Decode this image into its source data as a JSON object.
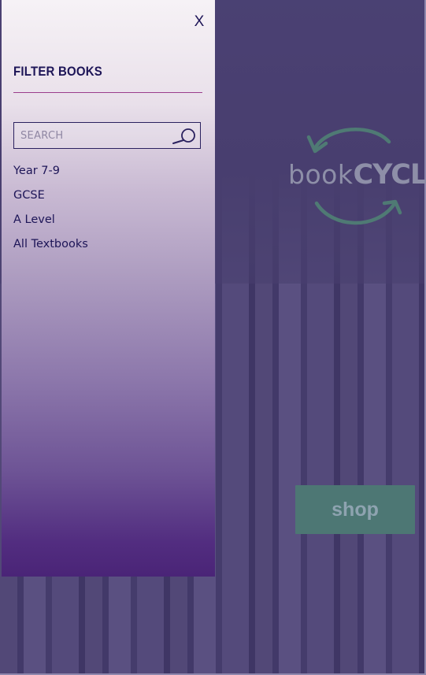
{
  "drawer": {
    "close_label": "X",
    "heading": "FILTER BOOKS",
    "search": {
      "placeholder": "SEARCH",
      "value": "",
      "icon": "search-icon"
    },
    "filters": [
      {
        "label": "Year 7-9"
      },
      {
        "label": "GCSE"
      },
      {
        "label": "A Level"
      },
      {
        "label": "All Textbooks"
      }
    ]
  },
  "hero": {
    "logo": {
      "word_book": "book",
      "word_cycle": "CYCLE",
      "icon": "recycle-arrows-icon"
    },
    "shop_label": "shop"
  },
  "colors": {
    "drawer_text": "#1d1557",
    "divider": "#9b3d8c",
    "shop_button": "#4d7774",
    "logo_green": "#4f7a74",
    "overlay_purple": "#4d446e"
  }
}
